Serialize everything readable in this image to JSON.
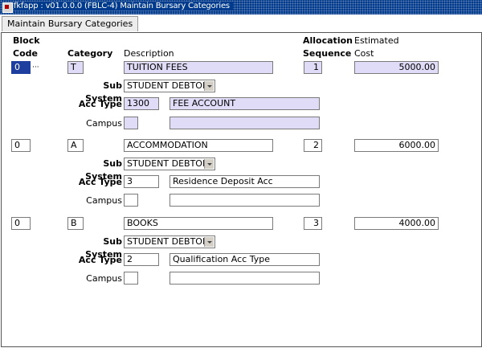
{
  "window": {
    "title": "fkfapp : v01.0.0.0 (FBLC-4) Maintain Bursary Categories"
  },
  "tabs": [
    {
      "label": "Maintain Bursary Categories"
    }
  ],
  "headers": {
    "block_line1": "Block",
    "block_line2": "Code",
    "category": "Category",
    "description": "Description",
    "allocation_line1": "Allocation",
    "allocation_line2": "Sequence",
    "estimated_line1": "Estimated",
    "estimated_line2": "Cost"
  },
  "labels": {
    "sub_system": "Sub System",
    "acc_type": "Acc Type",
    "campus": "Campus"
  },
  "records": [
    {
      "block_code": "0",
      "category": "T",
      "description": "TUITION FEES",
      "allocation_sequence": "1",
      "estimated_cost": "5000.00",
      "sub_system": "STUDENT DEBTORS",
      "acc_type_code": "1300",
      "acc_type_desc": "FEE ACCOUNT",
      "campus_code": "",
      "campus_desc": ""
    },
    {
      "block_code": "0",
      "category": "A",
      "description": "ACCOMMODATION",
      "allocation_sequence": "2",
      "estimated_cost": "6000.00",
      "sub_system": "STUDENT DEBTORS",
      "acc_type_code": "3",
      "acc_type_desc": "Residence Deposit Acc",
      "campus_code": "",
      "campus_desc": ""
    },
    {
      "block_code": "0",
      "category": "B",
      "description": "BOOKS",
      "allocation_sequence": "3",
      "estimated_cost": "4000.00",
      "sub_system": "STUDENT DEBTORS",
      "acc_type_code": "2",
      "acc_type_desc": "Qualification Acc Type",
      "campus_code": "",
      "campus_desc": ""
    }
  ],
  "colors": {
    "title_bar": "#003a8c",
    "current_record_fill": "#e0dcf8",
    "cursor_fill": "#1f3f9f"
  }
}
